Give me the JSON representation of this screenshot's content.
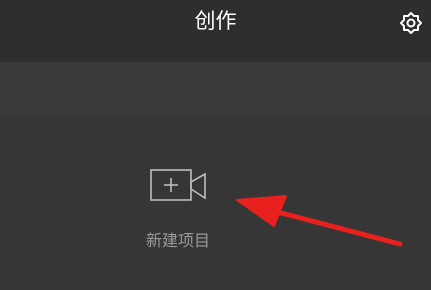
{
  "header": {
    "title": "创作",
    "settings_icon": "gear-icon"
  },
  "main": {
    "new_project": {
      "label": "新建项目",
      "icon": "video-camera-plus-icon"
    }
  },
  "annotation": {
    "arrow_color": "#e8201e"
  },
  "colors": {
    "background": "#363636",
    "header_background": "#2e2e2e",
    "band_background": "#3a3a3a",
    "title_text": "#ffffff",
    "label_text": "#9a9a9a",
    "icon_stroke": "#bdbdbd"
  }
}
